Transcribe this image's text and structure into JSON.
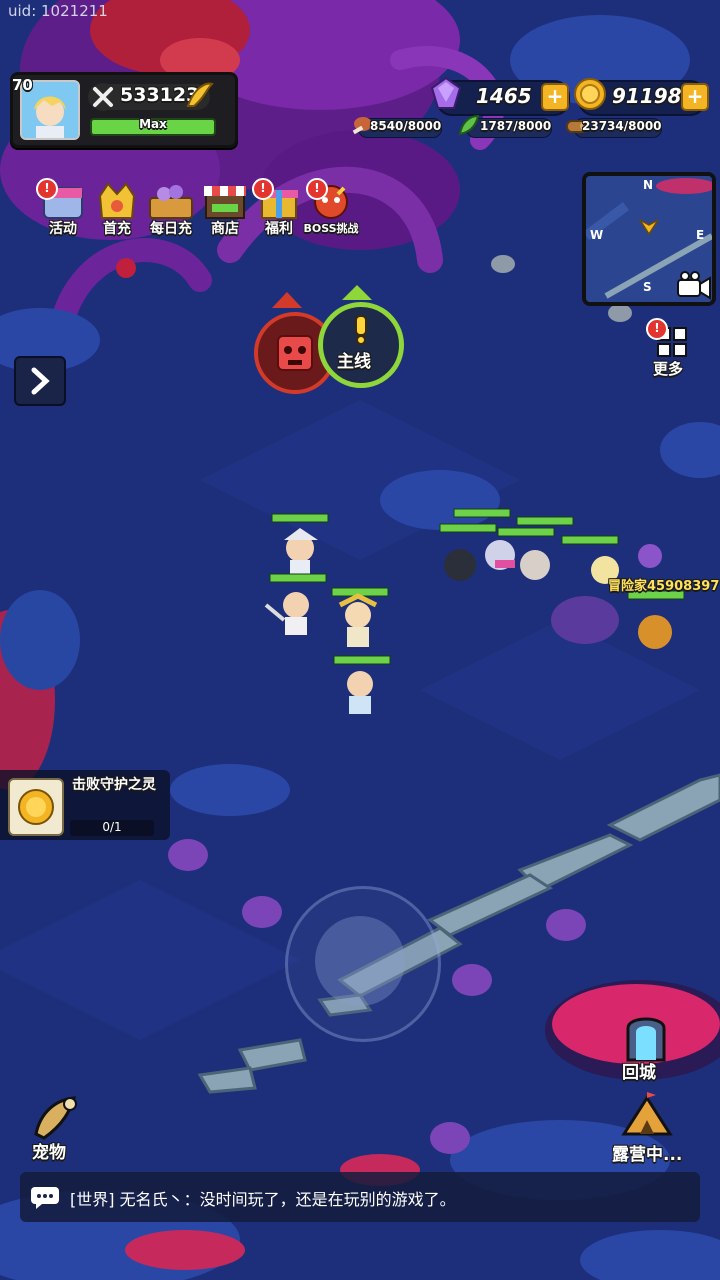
{
  "uid": "uid: 1021211",
  "player": {
    "level": "70",
    "power": "533123",
    "status": "Max"
  },
  "currency": {
    "gems": "1465",
    "gold": "91198",
    "add_symbol": "+"
  },
  "resources": {
    "meat": "8540/8000",
    "herb": "1787/8000",
    "wood": "23734/8000"
  },
  "menu": [
    {
      "label": "活动",
      "icon": "event-icon"
    },
    {
      "label": "首充",
      "icon": "first-charge-icon"
    },
    {
      "label": "每日充",
      "icon": "daily-charge-icon"
    },
    {
      "label": "商店",
      "icon": "shop-icon"
    },
    {
      "label": "福利",
      "icon": "welfare-icon"
    },
    {
      "label": "BOSS挑战",
      "icon": "boss-challenge-icon"
    }
  ],
  "badge_symbol": "!",
  "quest": {
    "main_label": "主线"
  },
  "minimap": {
    "n": "N",
    "s": "S",
    "e": "E",
    "w": "W"
  },
  "more_label": "更多",
  "player_tag": "冒险家45908397",
  "task": {
    "title": "击败守护之灵",
    "progress": "0/1"
  },
  "buttons": {
    "return_city": "回城",
    "camp": "露营中...",
    "pet": "宠物"
  },
  "chat": {
    "message": "[世界] 无名氏丶：没时间玩了，还是在玩别的游戏了。"
  },
  "colors": {
    "ground": "#1d2f7a",
    "hp_green": "#6dd24a",
    "gold": "#f3b523",
    "alert_red": "#e3342f",
    "quest_green": "#8fd63a"
  }
}
